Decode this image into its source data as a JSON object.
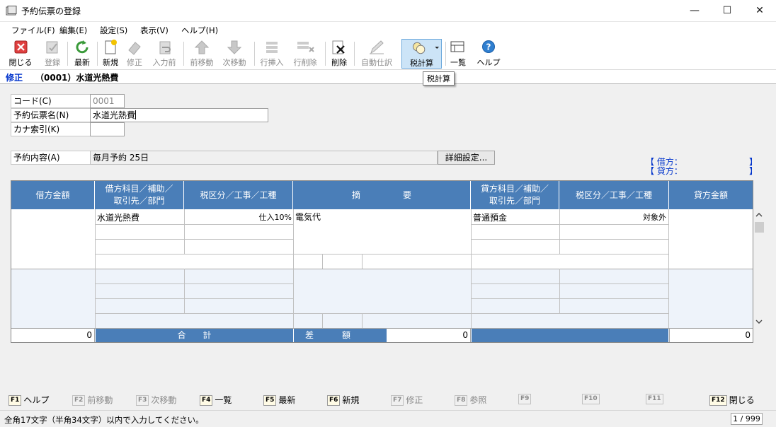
{
  "window": {
    "title": "予約伝票の登録",
    "minimize": "—",
    "maximize": "☐",
    "close": "✕"
  },
  "menu": [
    "ファイル(F)",
    "編集(E)",
    "設定(S)",
    "表示(V)",
    "ヘルプ(H)"
  ],
  "toolbar": {
    "close": "閉じる",
    "register": "登録",
    "latest": "最新",
    "new": "新規",
    "modify": "修正",
    "input_prev": "入力前",
    "prev_move": "前移動",
    "next_move": "次移動",
    "row_insert": "行挿入",
    "row_delete": "行削除",
    "delete": "削除",
    "auto_journal": "自動仕訳",
    "tax_calc": "税計算",
    "list": "一覧",
    "help": "ヘルプ"
  },
  "tooltip": "税計算",
  "mode": {
    "label": "修正",
    "title": "（0001）水道光熱費"
  },
  "form": {
    "code_label": "コード(C)",
    "code_value": "0001",
    "name_label": "予約伝票名(N)",
    "name_value": "水道光熱費",
    "kana_label": "カナ索引(K)",
    "kana_value": "",
    "content_label": "予約内容(A)",
    "content_value": "毎月予約 25日",
    "detail_button": "詳細設定..."
  },
  "balance": {
    "debit_label": "【 借方：",
    "credit_label": "【 貸方：",
    "close_bracket": "】"
  },
  "grid": {
    "headers": {
      "debit_amount": "借方金額",
      "debit_account_l1": "借方科目／補助／",
      "debit_account_l2": "取引先／部門",
      "debit_tax": "税区分／工事／工種",
      "description": "摘　　　　　要",
      "credit_account_l1": "貸方科目／補助／",
      "credit_account_l2": "取引先／部門",
      "credit_tax": "税区分／工事／工種",
      "credit_amount": "貸方金額"
    },
    "row1": {
      "debit_account": "水道光熱費",
      "debit_tax": "仕入10%",
      "description": "電気代",
      "credit_account": "普通預金",
      "credit_tax": "対象外"
    },
    "totals": {
      "debit_total": "0",
      "total_label": "合　　計",
      "diff_label": "差　　　額",
      "diff_value": "0",
      "credit_total": "0"
    }
  },
  "fkeys": [
    {
      "key": "F1",
      "label": "ヘルプ"
    },
    {
      "key": "F2",
      "label": "前移動"
    },
    {
      "key": "F3",
      "label": "次移動"
    },
    {
      "key": "F4",
      "label": "一覧"
    },
    {
      "key": "F5",
      "label": "最新"
    },
    {
      "key": "F6",
      "label": "新規"
    },
    {
      "key": "F7",
      "label": "修正"
    },
    {
      "key": "F8",
      "label": "参照"
    },
    {
      "key": "F9",
      "label": ""
    },
    {
      "key": "F10",
      "label": ""
    },
    {
      "key": "F11",
      "label": ""
    },
    {
      "key": "F12",
      "label": "閉じる"
    }
  ],
  "status": {
    "message": "全角17文字（半角34文字）以内で入力してください。",
    "page": "1 / 999"
  },
  "colors": {
    "header_blue": "#4a7eb8",
    "mode_blue": "#0033cc"
  }
}
